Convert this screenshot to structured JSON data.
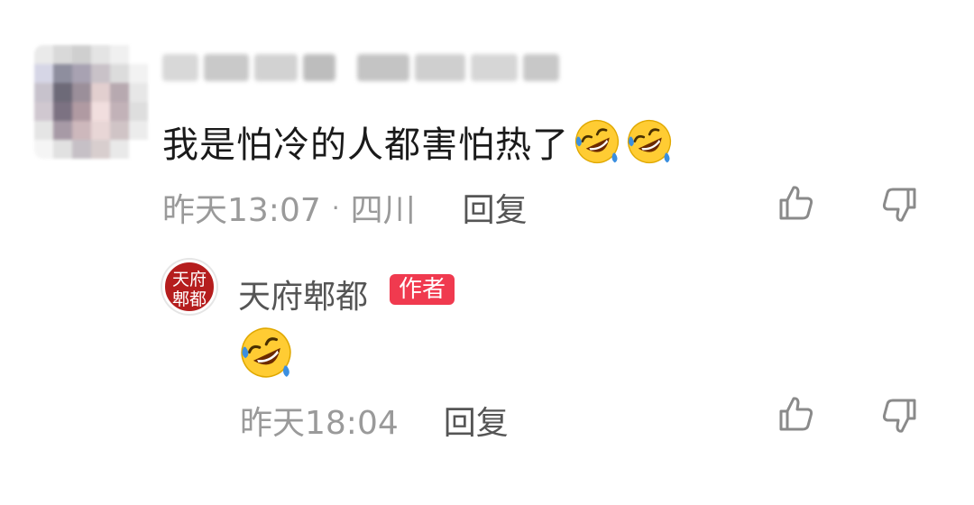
{
  "comment": {
    "text": "我是怕冷的人都害怕热了",
    "emoji_icons": [
      "rolling-on-floor-laughing-icon",
      "rolling-on-floor-laughing-icon"
    ],
    "time": "昨天13:07",
    "separator": "·",
    "location": "四川",
    "reply_label": "回复"
  },
  "author_reply": {
    "avatar_text": [
      "天",
      "府",
      "郫",
      "都"
    ],
    "name": "天府郫都",
    "badge": "作者",
    "emoji_icon": "rolling-on-floor-laughing-icon",
    "time": "昨天18:04",
    "reply_label": "回复"
  },
  "colors": {
    "text_primary": "#1a1a1a",
    "text_meta": "#9a9a9a",
    "badge_bg": "#f03a4f",
    "avatar_red": "#b51d1d",
    "emoji_yellow": "#ffcc33",
    "emoji_tear": "#3b8fe0"
  }
}
